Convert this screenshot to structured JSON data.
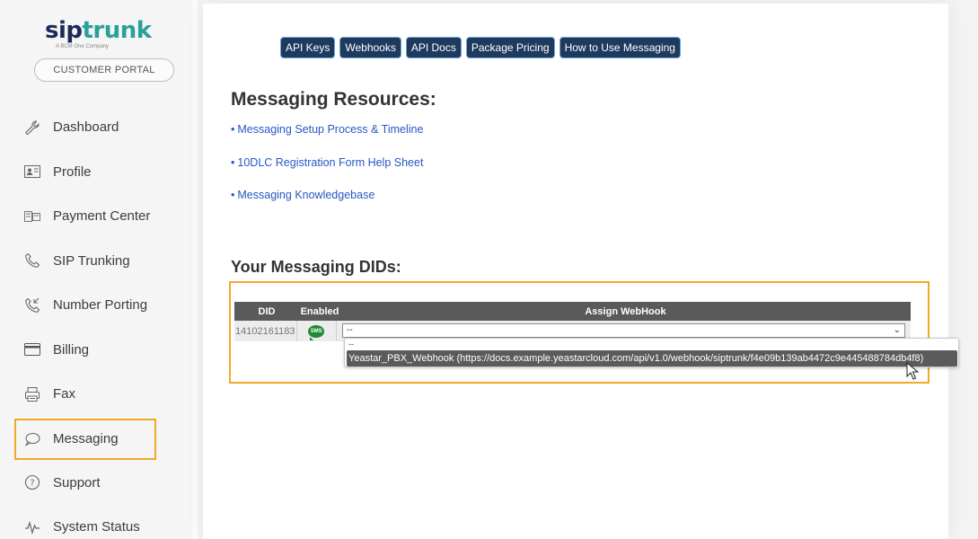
{
  "brand": {
    "logo_text_a": "sip",
    "logo_text_b": "trunk",
    "logo_tagline": "A BCM One Company",
    "portal_label": "CUSTOMER PORTAL"
  },
  "sidebar": {
    "items": [
      {
        "label": "Dashboard",
        "icon": "wrench-icon"
      },
      {
        "label": "Profile",
        "icon": "profile-card-icon"
      },
      {
        "label": "Payment Center",
        "icon": "payment-icon"
      },
      {
        "label": "SIP Trunking",
        "icon": "phone-icon"
      },
      {
        "label": "Number Porting",
        "icon": "phone-porting-icon"
      },
      {
        "label": "Billing",
        "icon": "credit-card-icon"
      },
      {
        "label": "Fax",
        "icon": "fax-icon"
      },
      {
        "label": "Messaging",
        "icon": "chat-bubble-icon",
        "active": true
      },
      {
        "label": "Support",
        "icon": "question-circle-icon"
      },
      {
        "label": "System Status",
        "icon": "pulse-icon"
      }
    ]
  },
  "tabs": [
    "API Keys",
    "Webhooks",
    "API Docs",
    "Package Pricing",
    "How to Use Messaging"
  ],
  "resources": {
    "heading": "Messaging Resources:",
    "links": [
      "Messaging Setup Process & Timeline",
      "10DLC Registration Form Help Sheet",
      "Messaging Knowledgebase"
    ],
    "bullet": "•"
  },
  "dids": {
    "heading": "Your Messaging DIDs:",
    "columns": [
      "DID",
      "Enabled",
      "Assign WebHook"
    ],
    "rows": [
      {
        "did": "14102161183",
        "enabled_icon": "sms-enabled-icon",
        "enabled_icon_text": "SMS",
        "webhook_value": "--"
      }
    ],
    "dropdown": {
      "blank_option": "--",
      "highlighted_option": "Yeastar_PBX_Webhook (https://docs.example.yeastarcloud.com/api/v1.0/webhook/siptrunk/f4e09b139ab4472c9e445488784db4f8)"
    },
    "caret": "⌄"
  },
  "colors": {
    "tab_bg": "#1f3a5f",
    "link": "#2857c5",
    "highlight": "#f3a82a",
    "enabled_green": "#1e8a34"
  }
}
